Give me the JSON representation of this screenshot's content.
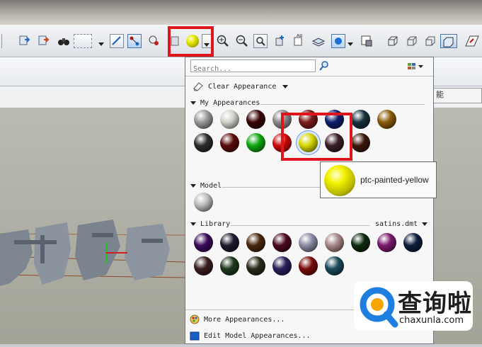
{
  "search": {
    "placeholder": "Search..."
  },
  "clear_appearance": "Clear Appearance",
  "sections": {
    "my_appearances": "My Appearances",
    "model": "Model",
    "library": "Library"
  },
  "library_file": "satins.dmt",
  "tooltip_text": "ptc-painted-yellow",
  "footer": {
    "more": "More Appearances...",
    "edit": "Edit Model Appearances..."
  },
  "side_label": "能",
  "watermark": {
    "brand": "查询啦",
    "url": "chaxunla.com"
  },
  "colors": {
    "highlight": "#e0141b",
    "brand_blue": "#1f7fe0"
  },
  "swatches": {
    "my_appearances": [
      "#9a9a9a",
      "#d2d2cc",
      "#3a0608",
      "#8a8a8a",
      "#7b1b1b",
      "#0d1e6e",
      "#16323c",
      "#8a5c0a",
      "#2c2c2c",
      "#5a0a08",
      "#0fa80f",
      "#c80808",
      "#d6d600",
      "#3a1e28",
      "#3b1808"
    ],
    "model": [
      "#bcbcbc"
    ],
    "library": [
      "#3a0a5a",
      "#1c1c2e",
      "#4a2810",
      "#4a0a1e",
      "#8a8aa4",
      "#a88888",
      "#0e2a0e",
      "#7a1a6a",
      "#0e1e3a",
      "#3a1e1e",
      "#1e3a1e",
      "#2a2a1a",
      "#2a1e5a",
      "#7a0a0a",
      "#1a4a5a"
    ]
  }
}
